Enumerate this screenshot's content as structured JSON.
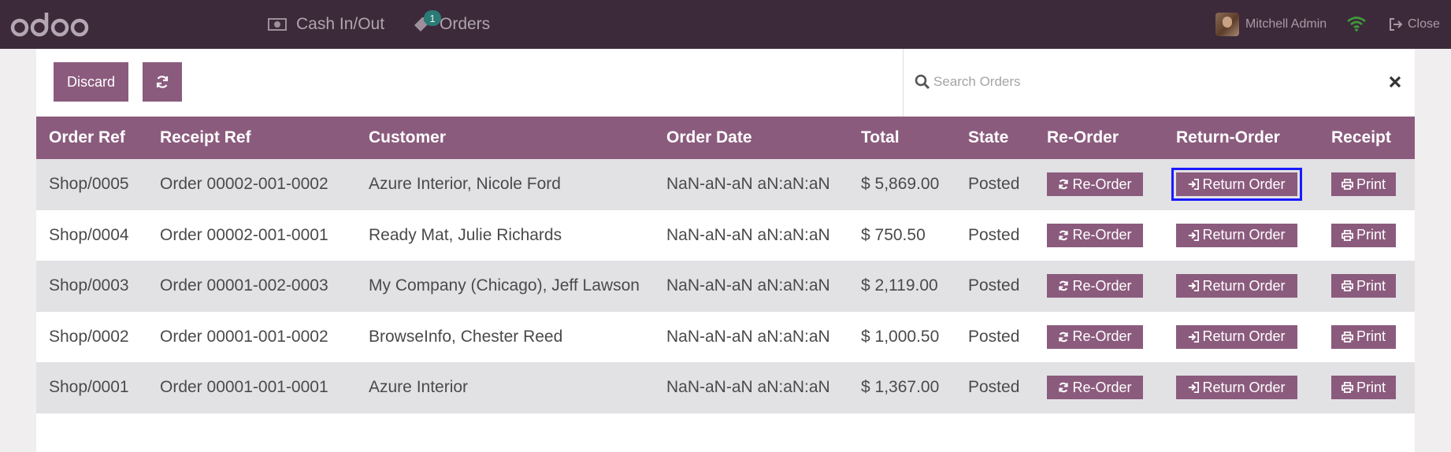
{
  "navbar": {
    "cash_label": "Cash In/Out",
    "orders_label": "Orders",
    "orders_badge": "1",
    "user_name": "Mitchell Admin",
    "close_label": "Close"
  },
  "controls": {
    "discard_label": "Discard",
    "search_placeholder": "Search Orders"
  },
  "table": {
    "headers": [
      "Order Ref",
      "Receipt Ref",
      "Customer",
      "Order Date",
      "Total",
      "State",
      "Re-Order",
      "Return-Order",
      "Receipt"
    ],
    "rows": [
      {
        "order_ref": "Shop/0005",
        "receipt_ref": "Order 00002-001-0002",
        "customer": "Azure Interior, Nicole Ford",
        "date": "NaN-aN-aN aN:aN:aN",
        "total": "$ 5,869.00",
        "state": "Posted"
      },
      {
        "order_ref": "Shop/0004",
        "receipt_ref": "Order 00002-001-0001",
        "customer": "Ready Mat, Julie Richards",
        "date": "NaN-aN-aN aN:aN:aN",
        "total": "$ 750.50",
        "state": "Posted"
      },
      {
        "order_ref": "Shop/0003",
        "receipt_ref": "Order 00001-002-0003",
        "customer": "My Company (Chicago), Jeff Lawson",
        "date": "NaN-aN-aN aN:aN:aN",
        "total": "$ 2,119.00",
        "state": "Posted"
      },
      {
        "order_ref": "Shop/0002",
        "receipt_ref": "Order 00001-001-0002",
        "customer": "BrowseInfo, Chester Reed",
        "date": "NaN-aN-aN aN:aN:aN",
        "total": "$ 1,000.50",
        "state": "Posted"
      },
      {
        "order_ref": "Shop/0001",
        "receipt_ref": "Order 00001-001-0001",
        "customer": "Azure Interior",
        "date": "NaN-aN-aN aN:aN:aN",
        "total": "$ 1,367.00",
        "state": "Posted"
      }
    ],
    "actions": {
      "reorder_label": "Re-Order",
      "return_label": "Return Order",
      "print_label": "Print"
    },
    "focused_row": 0
  },
  "colors": {
    "navbar_bg": "#3c2a3b",
    "accent": "#8b5b7d",
    "focus_ring": "#1a1aff",
    "badge": "#2a7b75"
  },
  "icons": [
    "odoo-logo",
    "cash-icon",
    "orders-tag-icon",
    "user-avatar",
    "wifi-icon",
    "sign-out-icon",
    "refresh-icon",
    "search-icon",
    "clear-icon",
    "sign-in-icon",
    "print-icon"
  ]
}
